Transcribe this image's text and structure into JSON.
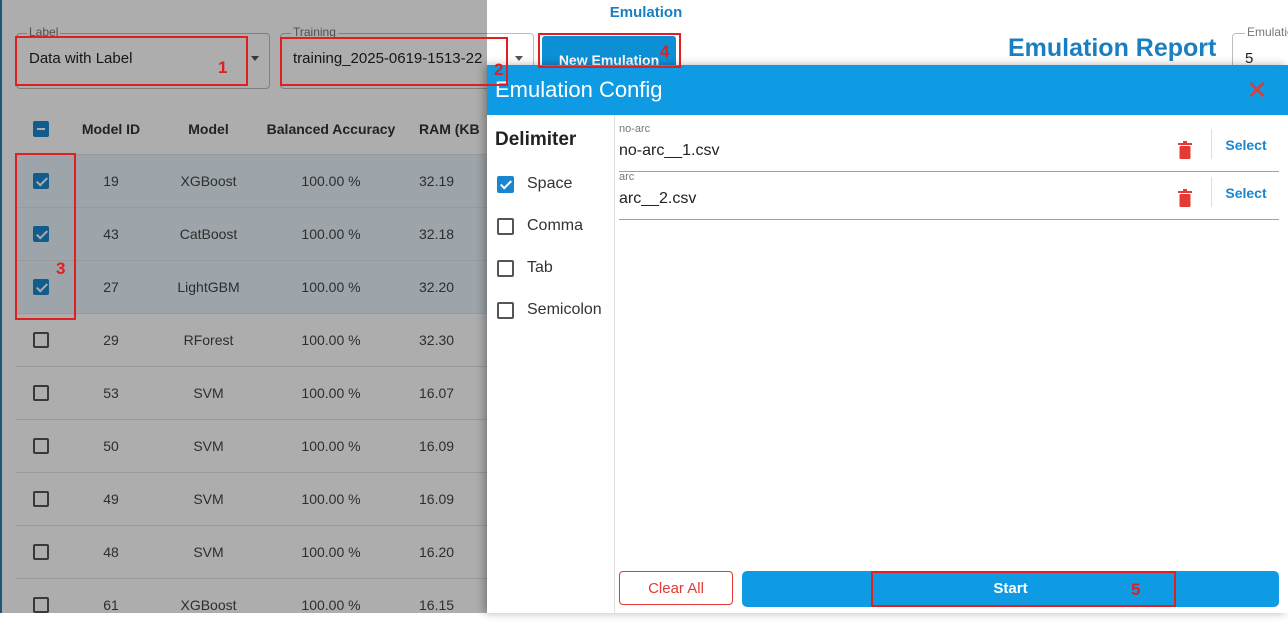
{
  "app": {
    "title": "Emulation"
  },
  "filters": {
    "label_field": {
      "label": "Label",
      "value": "Data with Label"
    },
    "training_field": {
      "label": "Training",
      "value": "training_2025-0619-1513-22"
    },
    "emulation_field": {
      "label": "Emulation",
      "value": "5"
    }
  },
  "toolbar": {
    "new_emulation": "New Emulation",
    "report_title": "Emulation Report"
  },
  "table": {
    "headers": [
      "Model ID",
      "Model",
      "Balanced Accuracy",
      "RAM (KB"
    ],
    "rows": [
      {
        "checked": true,
        "id": "19",
        "model": "XGBoost",
        "accuracy": "100.00 %",
        "ram": "32.19"
      },
      {
        "checked": true,
        "id": "43",
        "model": "CatBoost",
        "accuracy": "100.00 %",
        "ram": "32.18"
      },
      {
        "checked": true,
        "id": "27",
        "model": "LightGBM",
        "accuracy": "100.00 %",
        "ram": "32.20"
      },
      {
        "checked": false,
        "id": "29",
        "model": "RForest",
        "accuracy": "100.00 %",
        "ram": "32.30"
      },
      {
        "checked": false,
        "id": "53",
        "model": "SVM",
        "accuracy": "100.00 %",
        "ram": "16.07"
      },
      {
        "checked": false,
        "id": "50",
        "model": "SVM",
        "accuracy": "100.00 %",
        "ram": "16.09"
      },
      {
        "checked": false,
        "id": "49",
        "model": "SVM",
        "accuracy": "100.00 %",
        "ram": "16.09"
      },
      {
        "checked": false,
        "id": "48",
        "model": "SVM",
        "accuracy": "100.00 %",
        "ram": "16.20"
      },
      {
        "checked": false,
        "id": "61",
        "model": "XGBoost",
        "accuracy": "100.00 %",
        "ram": "16.15"
      }
    ]
  },
  "dialog": {
    "title": "Emulation Config",
    "close_icon": "close-icon",
    "delimiter_title": "Delimiter",
    "delimiters": [
      {
        "label": "Space",
        "checked": true
      },
      {
        "label": "Comma",
        "checked": false
      },
      {
        "label": "Tab",
        "checked": false
      },
      {
        "label": "Semicolon",
        "checked": false
      }
    ],
    "files": [
      {
        "label": "no-arc",
        "value": "no-arc__1.csv",
        "select": "Select"
      },
      {
        "label": "arc",
        "value": "arc__2.csv",
        "select": "Select"
      }
    ],
    "clear_all": "Clear All",
    "start": "Start"
  },
  "annotations": [
    "1",
    "2",
    "3",
    "4",
    "5"
  ],
  "colors": {
    "accent": "#0f9be3",
    "danger": "#e53935",
    "annotation": "#e02020"
  }
}
